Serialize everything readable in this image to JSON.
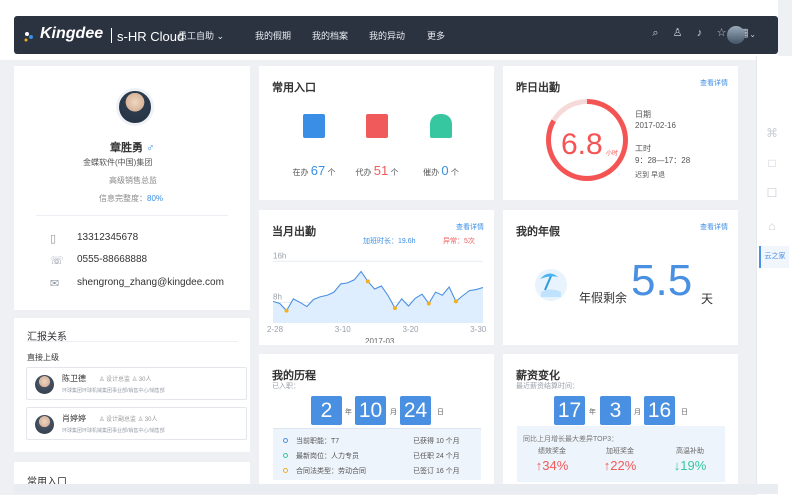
{
  "app": {
    "brand": "Kingdee",
    "product": "s-HR Cloud",
    "nav": [
      "员工自助",
      "我的假期",
      "我的档案",
      "我的异动",
      "更多"
    ],
    "nav_dropdown": "⌄",
    "icons": [
      "search-icon",
      "org-chart-icon",
      "bell-icon",
      "star-icon",
      "apps-icon"
    ]
  },
  "profile": {
    "name": "章胜勇",
    "gender_icon": "♂",
    "company": "金蝶软件(中国)集团",
    "title": "高级销售总监",
    "completion_label": "信息完整度：",
    "completion_value": "80%",
    "completion_pct": 80,
    "mobile": "13312345678",
    "phone": "0555-88668888",
    "email": "shengrong_zhang@kingdee.com"
  },
  "report": {
    "title": "汇报关系",
    "subtitle": "直接上级",
    "items": [
      {
        "name": "陈卫德",
        "role": "设计总监",
        "count": "30人",
        "dept": "环球集团环球机械集团事业部/销售中心/销售部"
      },
      {
        "name": "肖婷婷",
        "role": "设计副总监",
        "count": "30人",
        "dept": "环球集团环球机械集团事业部/销售中心/销售部"
      }
    ]
  },
  "left_bottom": {
    "title": "常用入口"
  },
  "common": {
    "title": "常用入口",
    "items": [
      {
        "label": "在办",
        "value": "67",
        "unit": "个",
        "color": "#3a8ee6",
        "icon": "inbox-icon"
      },
      {
        "label": "代办",
        "value": "51",
        "unit": "个",
        "color": "#f05a5a",
        "icon": "document-icon"
      },
      {
        "label": "催办",
        "value": "0",
        "unit": "个",
        "color": "#36c6a0",
        "icon": "bell-icon"
      }
    ]
  },
  "yesterday": {
    "title": "昨日出勤",
    "link": "查看详情",
    "value": "6.8",
    "unit": "小时",
    "date_label": "日期",
    "date": "2017-02-16",
    "time_label": "工时",
    "time": "9：28—17：28",
    "late": "迟到",
    "early": "早退"
  },
  "month": {
    "title": "当月出勤",
    "link": "查看详情",
    "overtime_label": "加班时长：19.6h",
    "abnormal_label": "异常：5次"
  },
  "leave": {
    "title": "我的年假",
    "link": "查看详情",
    "label": "年假剩余",
    "value": "5.5",
    "unit": "天"
  },
  "history": {
    "title": "我的历程",
    "subtitle": "已入职：",
    "years": "2",
    "months": "10",
    "days": "24",
    "year_unit": "年",
    "month_unit": "月",
    "day_unit": "日",
    "rows": [
      {
        "text": "当前职能：T7",
        "value": "已获得 10 个月",
        "color": "#4a90e2"
      },
      {
        "text": "最新岗位：人力专员",
        "value": "已任职 24 个月",
        "color": "#36c6a0"
      },
      {
        "text": "合同法类型：劳动合同",
        "value": "已签订 16 个月",
        "color": "#f2b01e"
      }
    ]
  },
  "salary": {
    "title": "薪资变化",
    "subtitle": "最近薪资结算时间：",
    "date_a": "17",
    "date_b": "3",
    "date_c": "16",
    "unit_a": "年",
    "unit_b": "月",
    "unit_c": "日",
    "compare_label": "同比上月增长最大差异TOP3：",
    "items": [
      {
        "label": "绩效奖金",
        "value": "↑34%",
        "color": "#f05a5a"
      },
      {
        "label": "加班奖金",
        "value": "↑22%",
        "color": "#f05a5a"
      },
      {
        "label": "高温补助",
        "value": "↓19%",
        "color": "#36c6a0"
      }
    ]
  },
  "rail": {
    "labels": [
      "云之家"
    ]
  },
  "chart_data": {
    "type": "line",
    "title": "当月出勤",
    "xlabel": "2017-03",
    "x": [
      "2-28",
      "3-1",
      "3-2",
      "3-3",
      "3-4",
      "3-5",
      "3-6",
      "3-7",
      "3-8",
      "3-9",
      "3-10",
      "3-11",
      "3-12",
      "3-13",
      "3-14",
      "3-15",
      "3-16",
      "3-17",
      "3-18",
      "3-19",
      "3-20",
      "3-21",
      "3-22",
      "3-23",
      "3-24",
      "3-25",
      "3-26",
      "3-27",
      "3-28",
      "3-29",
      "3-30",
      "3-31"
    ],
    "ticks": [
      "2-28",
      "3-10",
      "3-20",
      "3-30"
    ],
    "ylim": [
      4,
      18
    ],
    "series": [
      {
        "values": [
          8.2,
          7.8,
          6.4,
          8.7,
          8.0,
          7.2,
          8.6,
          9.1,
          9.4,
          10.0,
          11.6,
          11.8,
          12.4,
          14.0,
          12.1,
          10.6,
          11.2,
          9.3,
          6.9,
          8.7,
          7.3,
          8.8,
          9.6,
          7.8,
          10.0,
          9.4,
          11.0,
          8.2,
          9.3,
          10.3,
          10.5,
          10.9
        ]
      }
    ],
    "yticks": [
      "16h",
      "8h"
    ],
    "grid": true
  }
}
